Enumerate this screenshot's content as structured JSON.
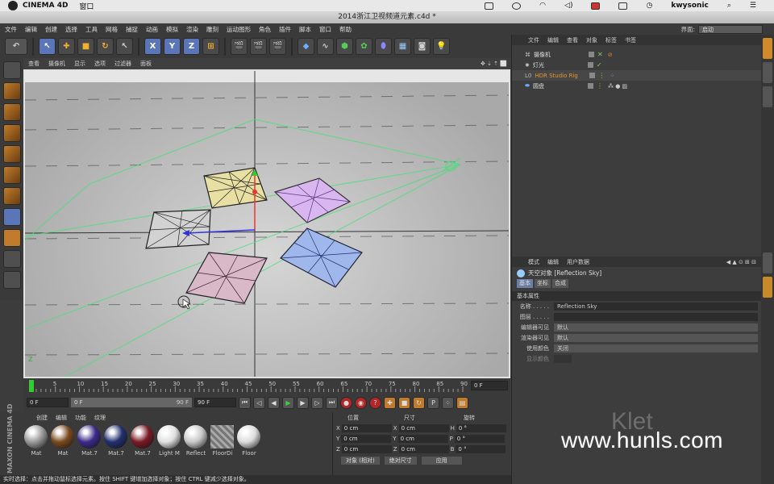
{
  "mac_menubar": {
    "app": "CINEMA 4D",
    "menu": "窗口",
    "user": "kwysonic"
  },
  "window_title": "2014浙江卫视频道元素.c4d *",
  "menus": [
    "文件",
    "编辑",
    "创建",
    "选择",
    "工具",
    "网格",
    "捕捉",
    "动画",
    "模拟",
    "渲染",
    "雕刻",
    "运动图形",
    "角色",
    "插件",
    "脚本",
    "窗口",
    "帮助"
  ],
  "layout": {
    "label": "界面:",
    "value": "启动"
  },
  "viewport": {
    "menu": [
      "查看",
      "摄像机",
      "显示",
      "选项",
      "过滤器",
      "面板"
    ],
    "axis_label": "Z"
  },
  "object_manager": {
    "menu": [
      "文件",
      "编辑",
      "查看",
      "对象",
      "标签",
      "书签"
    ],
    "objects": [
      {
        "name": "摄像机",
        "highlight": false
      },
      {
        "name": "灯光",
        "highlight": false
      },
      {
        "name": "HDR Studio Rig",
        "highlight": true
      },
      {
        "name": "圆盘",
        "highlight": false
      }
    ]
  },
  "attributes": {
    "menu": [
      "模式",
      "编辑",
      "用户数据"
    ],
    "title": "天空对象 [Reflection Sky]",
    "tabs": [
      "基本",
      "坐标",
      "合成"
    ],
    "section": "基本属性",
    "fields": [
      {
        "label": "名称 . . . . .",
        "value": "Reflection Sky"
      },
      {
        "label": "图层 . . . . .",
        "value": ""
      },
      {
        "label": "编辑器可见",
        "value": "默认"
      },
      {
        "label": "渲染器可见",
        "value": "默认"
      },
      {
        "label": "使用颜色",
        "value": "关闭"
      },
      {
        "label": "显示颜色",
        "value": ""
      }
    ]
  },
  "timeline": {
    "ticks": [
      "0",
      "5",
      "10",
      "15",
      "20",
      "25",
      "30",
      "35",
      "40",
      "45",
      "50",
      "55",
      "60",
      "65",
      "70",
      "75",
      "80",
      "85",
      "90"
    ],
    "current_frame": "0 F",
    "start_frame": "0 F",
    "range_start": "0 F",
    "range_end": "90 F",
    "end_frame": "90 F"
  },
  "material_manager": {
    "menu": [
      "创建",
      "编辑",
      "功能",
      "纹理"
    ],
    "materials": [
      {
        "name": "Mat",
        "color": "#9a9a9a"
      },
      {
        "name": "Mat",
        "color": "#7a4a1e"
      },
      {
        "name": "Mat.7",
        "color": "#3c2a8a"
      },
      {
        "name": "Mat.7",
        "color": "#22306e"
      },
      {
        "name": "Mat.7",
        "color": "#7a1a25"
      },
      {
        "name": "Light M",
        "color": "#e0e0e0"
      },
      {
        "name": "Reflect",
        "color": "#c8c8c8"
      },
      {
        "name": "FloorDi",
        "color": "#999999"
      },
      {
        "name": "Floor",
        "color": "#dddddd"
      }
    ]
  },
  "coordinates": {
    "headers": [
      "位置",
      "尺寸",
      "旋转"
    ],
    "rows": [
      {
        "axis": "X",
        "pos": "0 cm",
        "size_axis": "X",
        "size": "0 cm",
        "rot_axis": "H",
        "rot": "0 °"
      },
      {
        "axis": "Y",
        "pos": "0 cm",
        "size_axis": "Y",
        "size": "0 cm",
        "rot_axis": "P",
        "rot": "0 °"
      },
      {
        "axis": "Z",
        "pos": "0 cm",
        "size_axis": "Z",
        "size": "0 cm",
        "rot_axis": "B",
        "rot": "0 °"
      }
    ],
    "mode": "对象 (相对)",
    "size_mode": "绝对尺寸",
    "apply": "应用"
  },
  "statusbar": "实时选择：点击并拖动鼠标选择元素。按住 SHIFT 键增加选择对象；按住 CTRL 键减少选择对象。",
  "logo": "MAXON CINEMA 4D",
  "watermark": "www.hunls.com",
  "watermark_faint": "Klet"
}
